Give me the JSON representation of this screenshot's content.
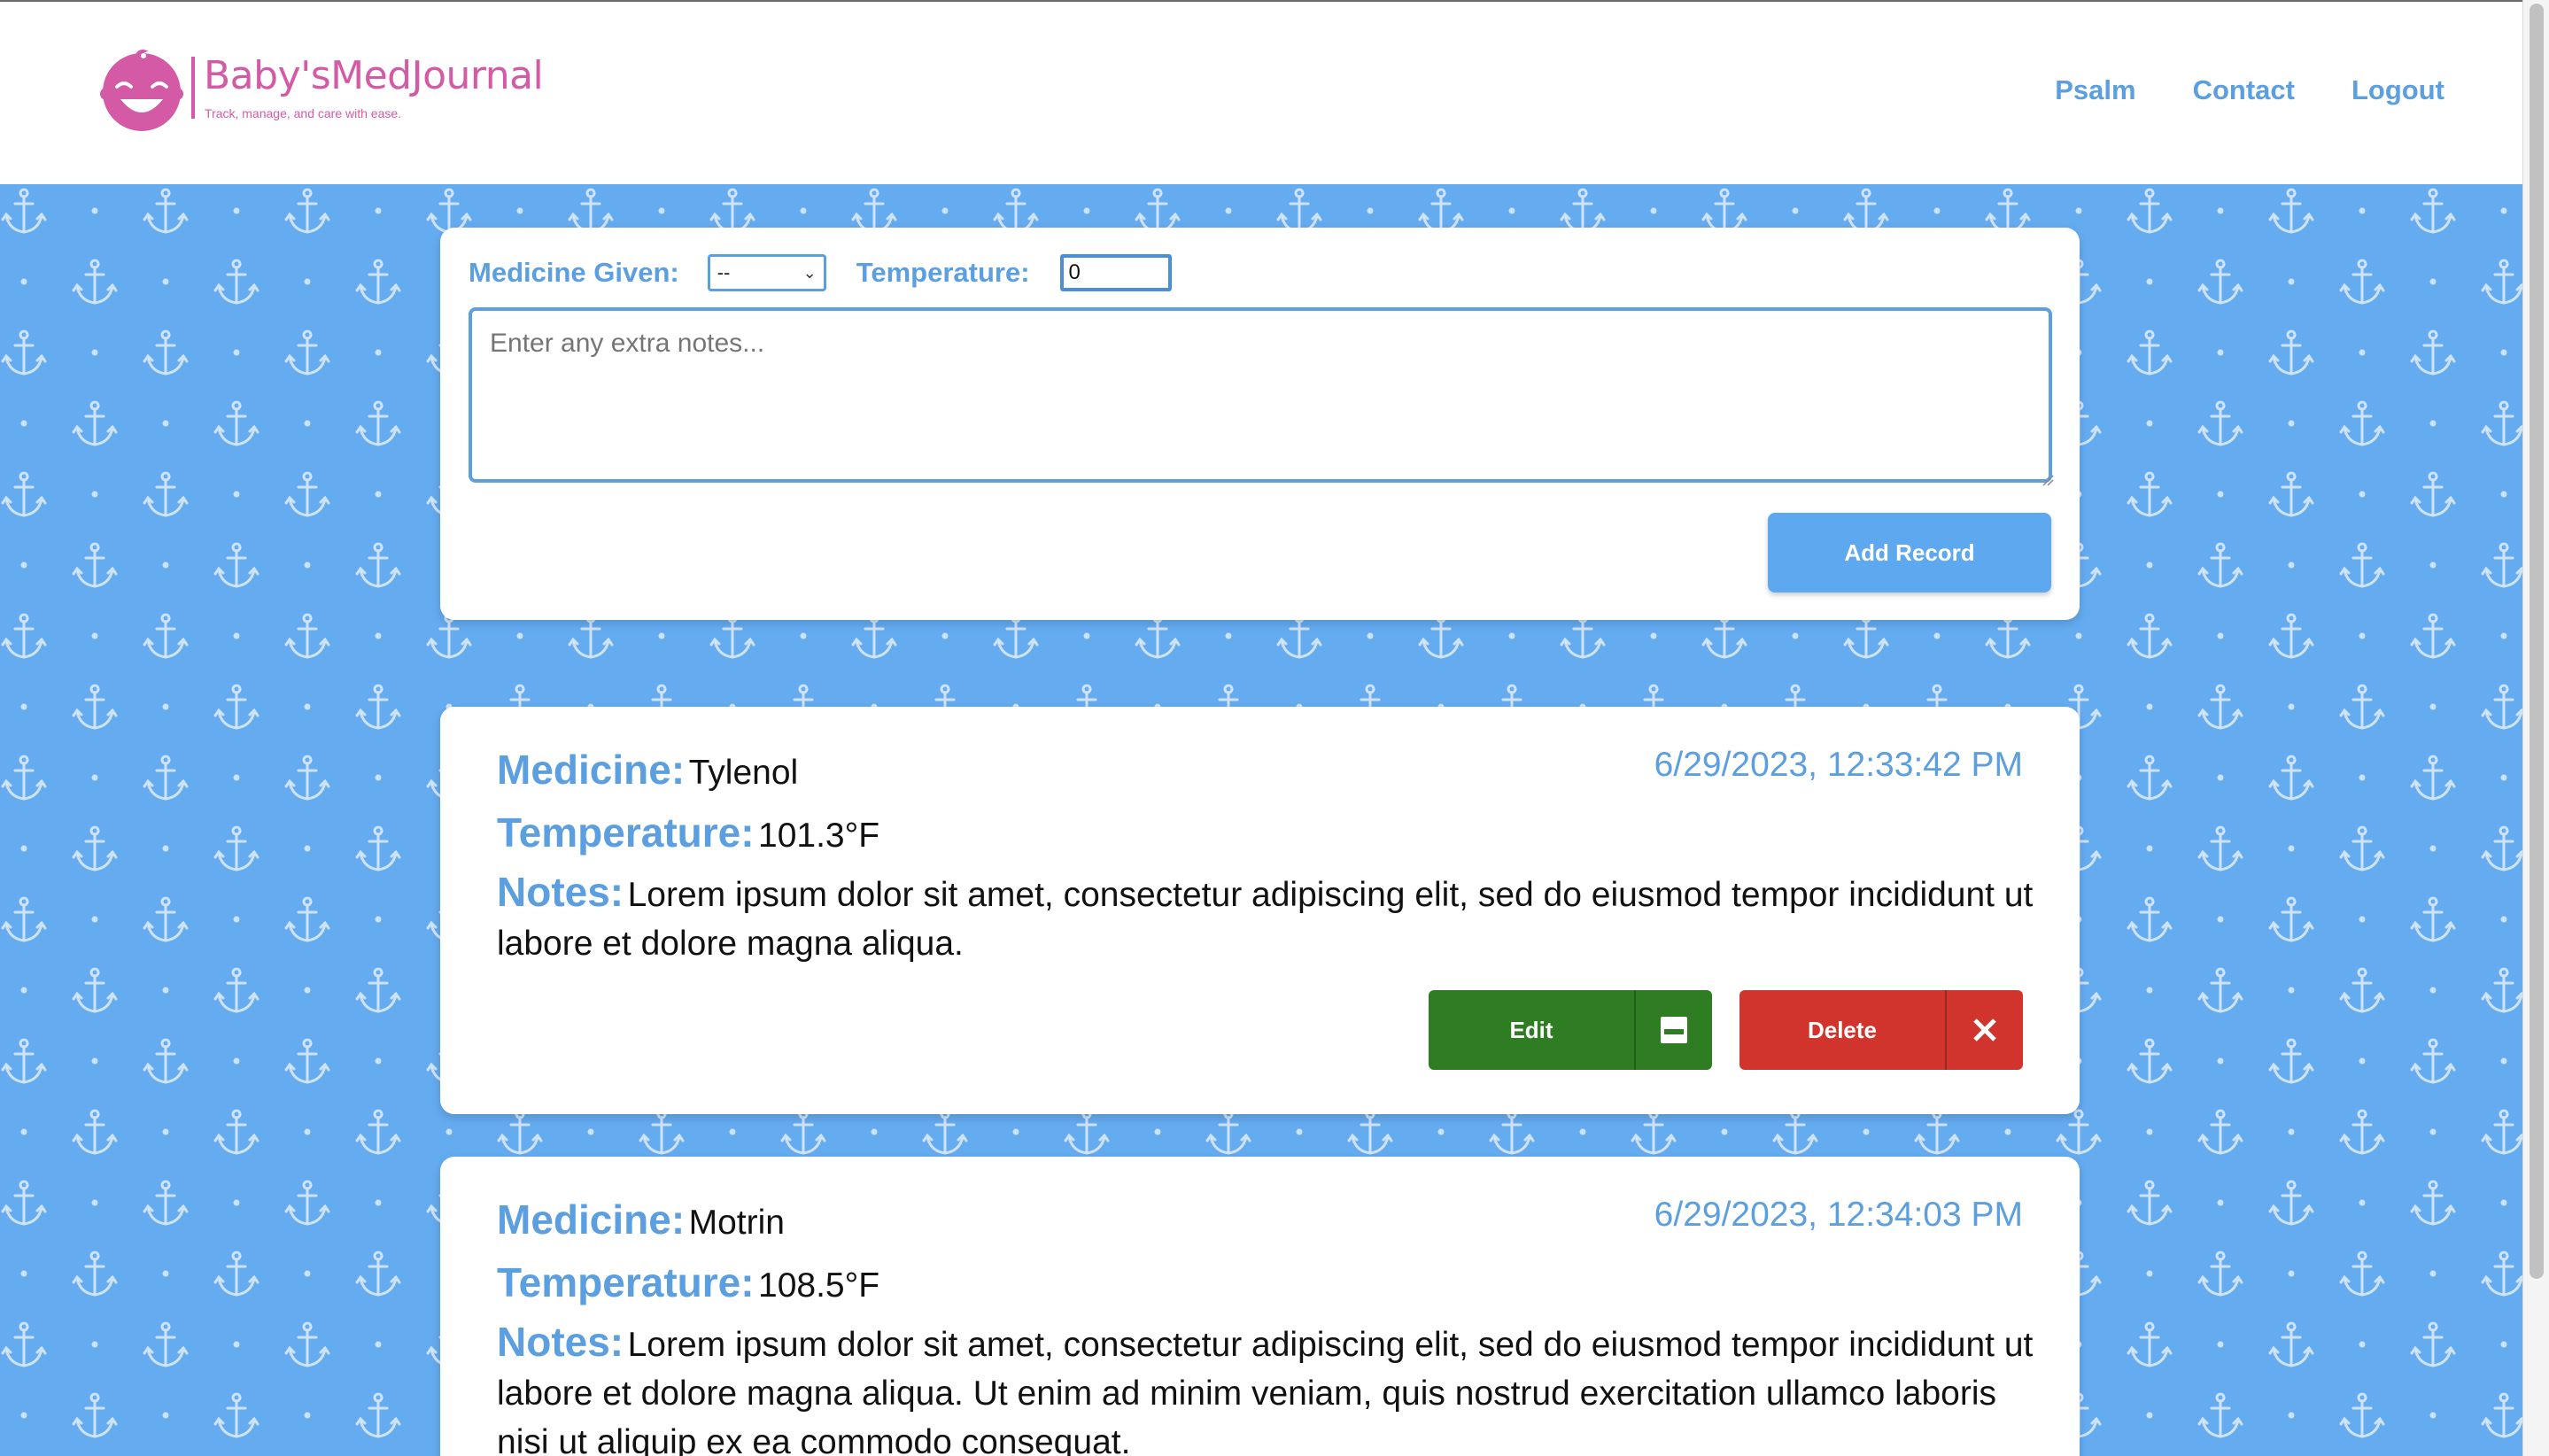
{
  "app": {
    "name": "Baby'sMedJournal",
    "tagline": "Track, manage, and care with ease."
  },
  "nav": {
    "items": [
      "Psalm",
      "Contact",
      "Logout"
    ]
  },
  "form": {
    "medicine_label": "Medicine Given:",
    "medicine_selected": "--",
    "temperature_label": "Temperature:",
    "temperature_value": "0",
    "notes_placeholder": "Enter any extra notes...",
    "add_label": "Add Record"
  },
  "labels": {
    "medicine": "Medicine:",
    "temperature": "Temperature:",
    "notes": "Notes:",
    "edit": "Edit",
    "delete": "Delete"
  },
  "records": [
    {
      "medicine": "Tylenol",
      "temperature": "101.3°F",
      "timestamp": "6/29/2023, 12:33:42 PM",
      "notes": "Lorem ipsum dolor sit amet, consectetur adipiscing elit, sed do eiusmod tempor incididunt ut labore et dolore magna aliqua."
    },
    {
      "medicine": "Motrin",
      "temperature": "108.5°F",
      "timestamp": "6/29/2023, 12:34:03 PM",
      "notes": "Lorem ipsum dolor sit amet, consectetur adipiscing elit, sed do eiusmod tempor incididunt ut labore et dolore magna aliqua. Ut enim ad minim veniam, quis nostrud exercitation ullamco laboris nisi ut aliquip ex ea commodo consequat."
    }
  ],
  "icons": {
    "logo": "baby-face-icon",
    "edit": "save-icon",
    "delete": "close-icon",
    "background": "anchor-icon"
  },
  "colors": {
    "background": "#64abf0",
    "accent": "#5b9fe0",
    "brand": "#d45aa6",
    "edit": "#2e7d22",
    "delete": "#d0342c"
  }
}
